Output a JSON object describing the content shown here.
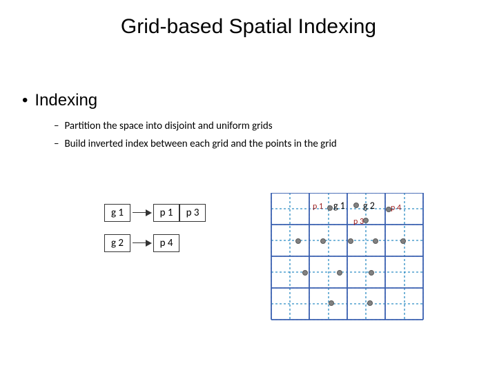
{
  "title": "Grid-based Spatial Indexing",
  "bullet": "Indexing",
  "sub_bullets": [
    "Partition the space into disjoint and uniform grids",
    "Build inverted index between each grid and the points in the grid"
  ],
  "inverted_index": [
    {
      "grid": "g 1",
      "postings": [
        "p 1",
        "p 3"
      ]
    },
    {
      "grid": "g 2",
      "postings": [
        "p 4"
      ]
    }
  ],
  "grid_labels": {
    "g1": "g 1",
    "g2": "g 2"
  },
  "point_labels": {
    "p1": "p 1",
    "p3": "p 3",
    "p4": "p 4"
  }
}
